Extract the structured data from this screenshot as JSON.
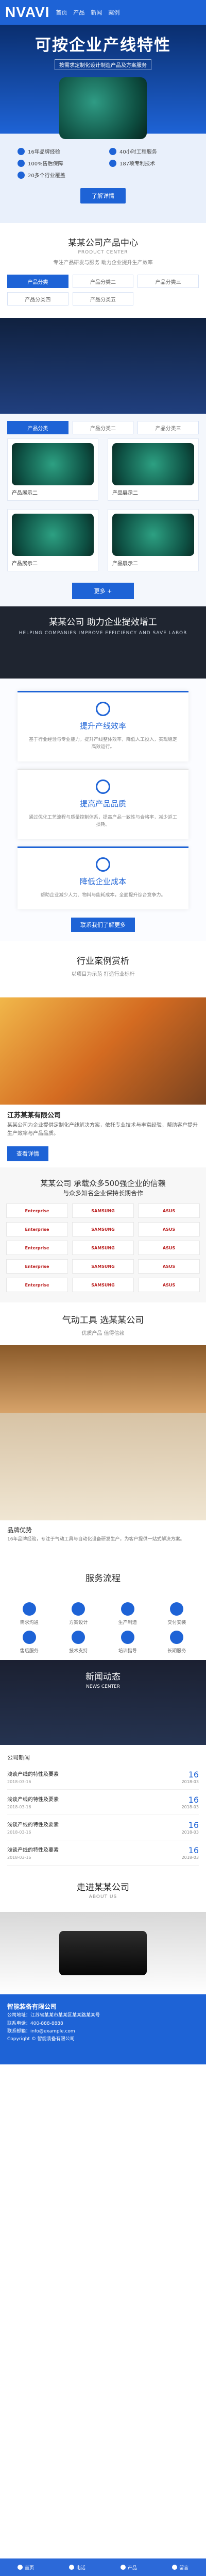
{
  "header": {
    "logo": "NVAVI",
    "nav": [
      "首页",
      "产品",
      "新闻",
      "案例"
    ]
  },
  "hero": {
    "title": "可按企业产线特性",
    "subtitle": "按需求定制化设计制造产品及方案服务",
    "features": [
      "16年品牌经验",
      "40小时工程服务",
      "100%售后保障",
      "187项专利技术",
      "20多个行业覆盖"
    ],
    "button": "了解详情"
  },
  "products": {
    "title": "某某公司产品中心",
    "en": "PRODUCT CENTER",
    "desc": "专注产品研发与服务 助力企业提升生产效率",
    "tabs": [
      "产品分类",
      "产品分类二",
      "产品分类三",
      "产品分类四",
      "产品分类五"
    ],
    "items": [
      "产品展示二",
      "产品展示二",
      "产品展示二",
      "产品展示二"
    ],
    "more": "更多 +"
  },
  "benefit": {
    "title": "某某公司 助力企业提效增工",
    "en": "HELPING COMPANIES IMPROVE EFFICIENCY AND SAVE LABOR",
    "cards": [
      {
        "title": "提升产线效率",
        "text": "基于行业经验与专业能力，提升产线整体效率，降低人工投入，实现稳定高效运行。"
      },
      {
        "title": "提高产品品质",
        "text": "通过优化工艺流程与质量控制体系，提高产品一致性与合格率，减少返工损耗。"
      },
      {
        "title": "降低企业成本",
        "text": "帮助企业减少人力、物料与能耗成本，全面提升综合竞争力。"
      }
    ],
    "cta": "联系我们了解更多"
  },
  "cases": {
    "title": "行业案例赏析",
    "sub": "以项目为示范 打造行业标杆",
    "info_title": "江苏某某有限公司",
    "info_text": "某某公司为企业提供定制化产线解决方案，依托专业技术与丰富经验，帮助客户提升生产效率与产品品质。",
    "button": "查看详情"
  },
  "partners": {
    "title": "某某公司 承载众多500强企业的信赖",
    "sub": "与众多知名企业保持长期合作",
    "logos": [
      "Enterprise",
      "SAMSUNG",
      "ASUS",
      "Enterprise",
      "SAMSUNG",
      "ASUS",
      "Enterprise",
      "SAMSUNG",
      "ASUS",
      "Enterprise",
      "SAMSUNG",
      "ASUS",
      "Enterprise",
      "SAMSUNG",
      "ASUS"
    ]
  },
  "product2": {
    "title": "气动工具 选某某公司",
    "sub": "优质产品 值得信赖",
    "headline": "品牌优势",
    "text": "16年品牌经验，专注于气动工具与自动化设备研发生产，为客户提供一站式解决方案。"
  },
  "process": {
    "title": "服务流程",
    "steps": [
      "需求沟通",
      "方案设计",
      "生产制造",
      "交付安装",
      "售后服务",
      "技术支持",
      "培训指导",
      "长期服务"
    ]
  },
  "news": {
    "title": "新闻动态",
    "en": "NEWS CENTER",
    "tag": "公司新闻",
    "items": [
      {
        "title": "浅谈产线的特性及要素",
        "date": "2018-03-16",
        "day": "16",
        "month": "2018-03"
      },
      {
        "title": "浅谈产线的特性及要素",
        "date": "2018-03-16",
        "day": "16",
        "month": "2018-03"
      },
      {
        "title": "浅谈产线的特性及要素",
        "date": "2018-03-16",
        "day": "16",
        "month": "2018-03"
      },
      {
        "title": "浅谈产线的特性及要素",
        "date": "2018-03-16",
        "day": "16",
        "month": "2018-03"
      }
    ]
  },
  "cta": {
    "title": "走进某某公司",
    "en": "ABOUT US"
  },
  "footer": {
    "company": "智能装备有限公司",
    "address": "公司地址：江苏省某某市某某区某某路某某号",
    "phone": "联系电话：400-888-8888",
    "email": "联系邮箱：info@example.com",
    "copyright": "Copyright © 智能装备有限公司"
  },
  "bottombar": [
    "首页",
    "电话",
    "产品",
    "留言"
  ]
}
